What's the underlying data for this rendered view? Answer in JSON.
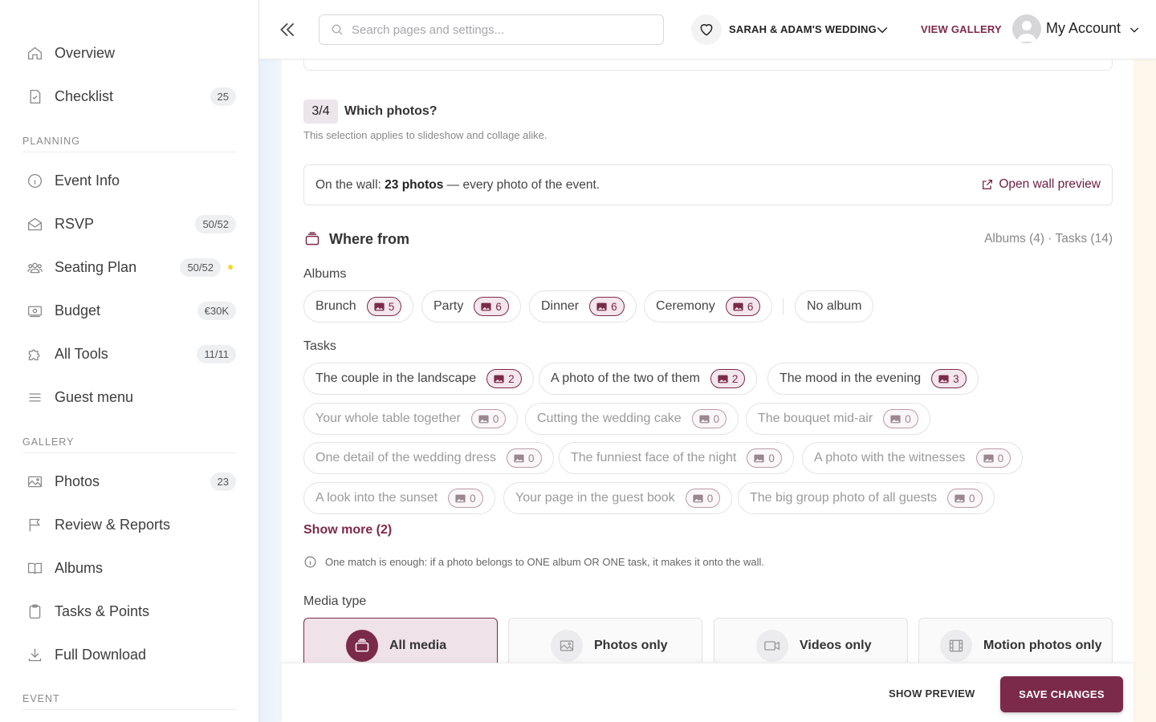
{
  "sidebar": {
    "items_top": [
      {
        "label": "Overview",
        "icon": "home-icon"
      },
      {
        "label": "Checklist",
        "icon": "checklist-icon",
        "badge": "25"
      }
    ],
    "sections": [
      {
        "title": "PLANNING"
      },
      {
        "title": "GALLERY"
      },
      {
        "title": "EVENT"
      }
    ],
    "planning": [
      {
        "label": "Event Info",
        "icon": "info-icon"
      },
      {
        "label": "RSVP",
        "icon": "envelope-icon",
        "badge": "50/52"
      },
      {
        "label": "Seating Plan",
        "icon": "people-icon",
        "badge": "50/52"
      },
      {
        "label": "Budget",
        "icon": "money-icon",
        "badge": "€30K"
      },
      {
        "label": "All Tools",
        "icon": "puzzle-icon",
        "badge": "11/11"
      },
      {
        "label": "Guest menu",
        "icon": "menu-icon"
      }
    ],
    "gallery": [
      {
        "label": "Photos",
        "icon": "image-icon",
        "badge": "23"
      },
      {
        "label": "Review & Reports",
        "icon": "flag-icon"
      },
      {
        "label": "Albums",
        "icon": "book-icon"
      },
      {
        "label": "Tasks & Points",
        "icon": "clipboard-icon"
      },
      {
        "label": "Full Download",
        "icon": "download-icon"
      }
    ]
  },
  "header": {
    "search_placeholder": "Search pages and settings...",
    "event_name": "SARAH & ADAM'S WEDDING",
    "view_gallery": "VIEW GALLERY",
    "account": "My Account"
  },
  "step": {
    "number": "3/4",
    "title": "Which photos?",
    "subtitle": "This selection applies to slideshow and collage alike."
  },
  "wall": {
    "prefix": "On the wall: ",
    "count": "23 photos",
    "suffix": " — every photo of the event.",
    "open_preview": "Open wall preview"
  },
  "where_from": {
    "title": "Where from",
    "counts": "Albums (4) · Tasks (14)"
  },
  "albums": {
    "label": "Albums",
    "items": [
      {
        "label": "Brunch",
        "count": "5"
      },
      {
        "label": "Party",
        "count": "6"
      },
      {
        "label": "Dinner",
        "count": "6"
      },
      {
        "label": "Ceremony",
        "count": "6"
      },
      {
        "label": "No album"
      }
    ]
  },
  "tasks": {
    "label": "Tasks",
    "items": [
      {
        "label": "The couple in the landscape",
        "count": "2"
      },
      {
        "label": "A photo of the two of them",
        "count": "2"
      },
      {
        "label": "The mood in the evening",
        "count": "3"
      },
      {
        "label": "Your whole table together",
        "count": "0"
      },
      {
        "label": "Cutting the wedding cake",
        "count": "0"
      },
      {
        "label": "The bouquet mid-air",
        "count": "0"
      },
      {
        "label": "One detail of the wedding dress",
        "count": "0"
      },
      {
        "label": "The funniest face of the night",
        "count": "0"
      },
      {
        "label": "A photo with the witnesses",
        "count": "0"
      },
      {
        "label": "A look into the sunset",
        "count": "0"
      },
      {
        "label": "Your page in the guest book",
        "count": "0"
      },
      {
        "label": "The big group photo of all guests",
        "count": "0"
      }
    ],
    "show_more": "Show more (2)"
  },
  "info_text": "One match is enough: if a photo belongs to ONE album OR ONE task, it makes it onto the wall.",
  "media": {
    "label": "Media type",
    "options": [
      {
        "label": "All media",
        "icon": "stack-icon",
        "selected": true
      },
      {
        "label": "Photos only",
        "icon": "photo-icon"
      },
      {
        "label": "Videos only",
        "icon": "video-icon"
      },
      {
        "label": "Motion photos only",
        "icon": "film-icon"
      }
    ]
  },
  "footer": {
    "show_preview": "SHOW PREVIEW",
    "save": "SAVE CHANGES"
  },
  "colors": {
    "accent": "#7b2a4a",
    "accent_light": "#efe2e8",
    "notification_dot": "#f5d833"
  }
}
